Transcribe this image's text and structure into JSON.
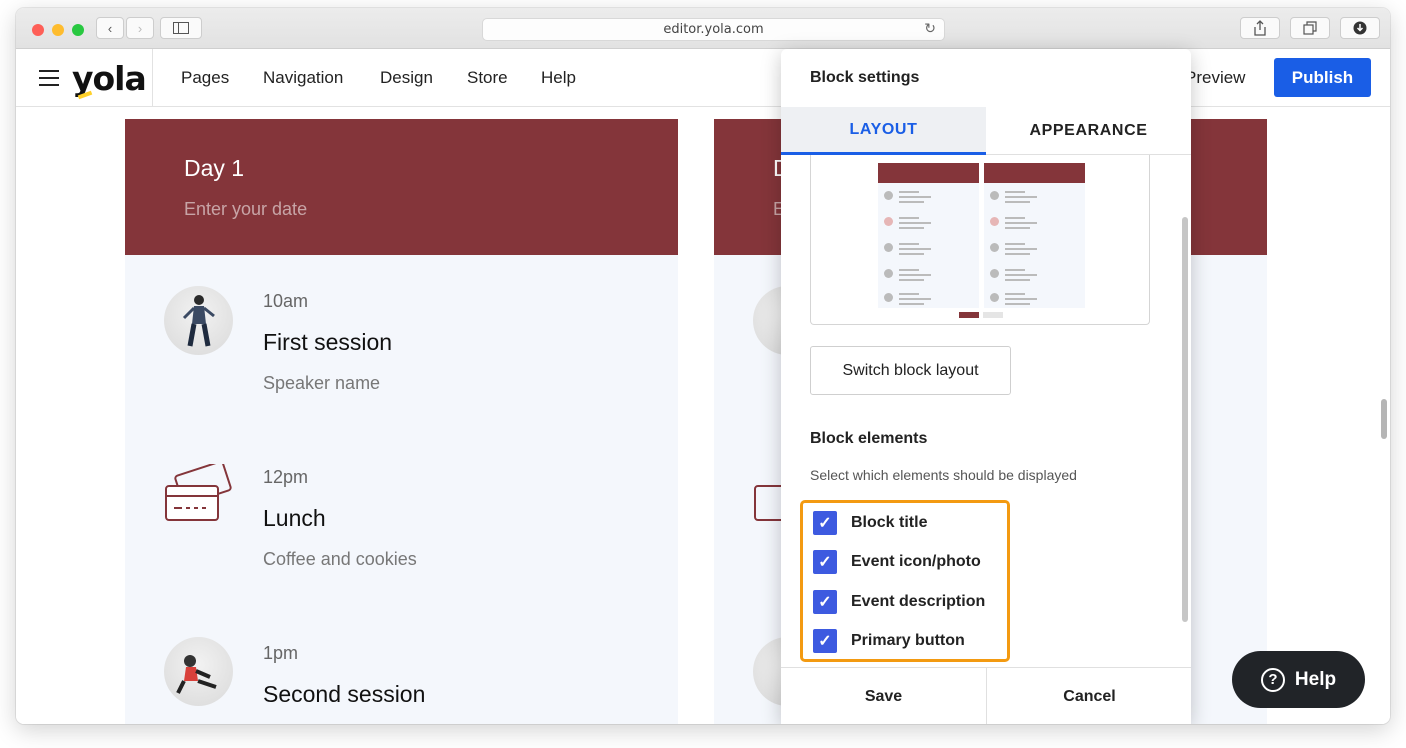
{
  "browser": {
    "url": "editor.yola.com"
  },
  "header": {
    "logo": "yola",
    "nav": [
      "Pages",
      "Navigation",
      "Design",
      "Store",
      "Help"
    ],
    "preview": "Preview",
    "publish": "Publish"
  },
  "columns": [
    {
      "day": "Day 1",
      "date_placeholder": "Enter your date",
      "events": [
        {
          "time": "10am",
          "title": "First session",
          "desc": "Speaker name",
          "icon": "speaker-photo"
        },
        {
          "time": "12pm",
          "title": "Lunch",
          "desc": "Coffee and cookies",
          "icon": "ticket-icon"
        },
        {
          "time": "1pm",
          "title": "Second session",
          "desc": "",
          "icon": "speaker-photo"
        }
      ]
    },
    {
      "day": "D",
      "date_placeholder": "E"
    }
  ],
  "panel": {
    "title": "Block settings",
    "tabs": [
      "LAYOUT",
      "APPEARANCE"
    ],
    "switch_button": "Switch block layout",
    "elements_title": "Block elements",
    "elements_subtitle": "Select which elements should be displayed",
    "elements": [
      {
        "label": "Block title",
        "checked": true
      },
      {
        "label": "Event icon/photo",
        "checked": true
      },
      {
        "label": "Event description",
        "checked": true
      },
      {
        "label": "Primary button",
        "checked": true
      }
    ],
    "save": "Save",
    "cancel": "Cancel"
  },
  "help_button": "Help",
  "colors": {
    "accent": "#1a5ee6",
    "header_bg": "#84353a",
    "highlight": "#f39a11",
    "checkbox": "#3d5ae0"
  }
}
